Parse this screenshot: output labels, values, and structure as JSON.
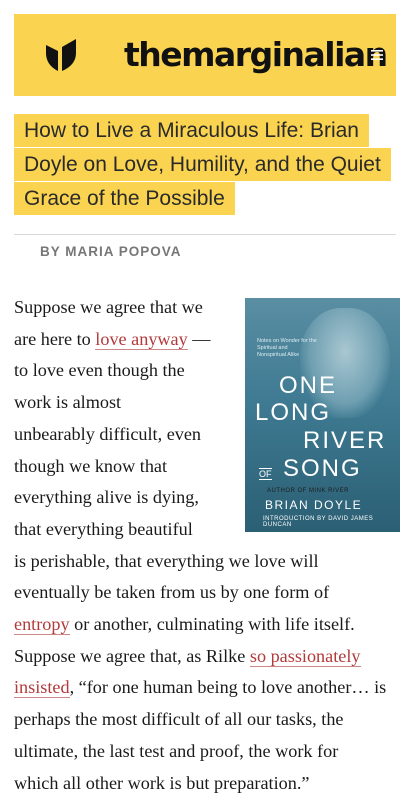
{
  "header": {
    "brand_prefix": "the",
    "brand_name": "marginalian",
    "colors": {
      "accent": "#fad450",
      "link": "#b33a3a"
    },
    "icons": {
      "logo": "marginalian-logo-icon",
      "menu": "menu-icon"
    }
  },
  "article": {
    "title_lines": [
      "How to Live a Miraculous Life: Brian",
      "Doyle on Love, Humility, and the Quiet",
      "Grace of the Possible"
    ],
    "byline": "BY MARIA POPOVA",
    "book": {
      "blurb": "Notes on Wonder for the Spiritual and Nonspiritual Alike",
      "title_words": [
        "ONE",
        "LONG",
        "RIVER",
        "OF",
        "SONG"
      ],
      "subtitle": "AUTHOR OF MINK RIVER",
      "author": "BRIAN DOYLE",
      "intro": "INTRODUCTION BY DAVID JAMES DUNCAN"
    },
    "body": {
      "l1": "Suppose we agree that we",
      "l2_a": "are here to ",
      "l2_link": "love anyway",
      "l2_b": " —",
      "l3": "to love even though the",
      "l4": "work is almost",
      "l5": "unbearably difficult, even",
      "l6": "though we know that",
      "l7": "everything alive is dying,",
      "l8": "that everything beautiful",
      "l9": "is perishable, that everything we love will",
      "l10": "eventually be taken from us by one form of",
      "l11_link": "entropy",
      "l11_b": " or another, culminating with life itself.",
      "l12_a": "Suppose we agree that, as Rilke ",
      "l12_link": "so passionately",
      "l13_link": "insisted",
      "l13_b": ", “for one human being to love another… is",
      "l14": "perhaps the most difficult of all our tasks, the",
      "l15": "ultimate, the last test and proof, the work for",
      "l16": "which all other work is but preparation.”"
    }
  }
}
